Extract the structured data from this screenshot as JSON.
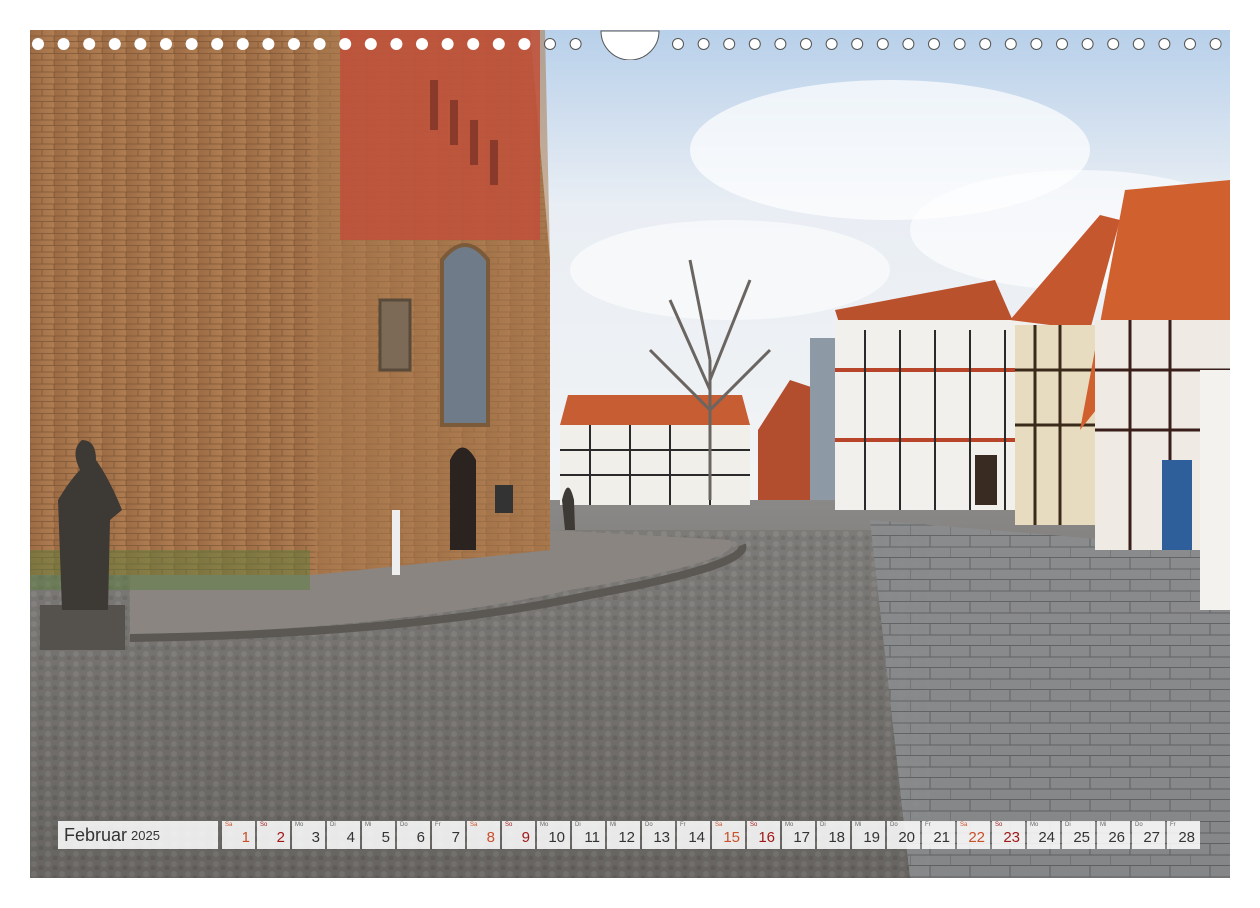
{
  "calendar": {
    "month": "Februar",
    "year": "2025",
    "days": [
      {
        "wd": "Sa",
        "d": "1",
        "t": "sat"
      },
      {
        "wd": "So",
        "d": "2",
        "t": "sun"
      },
      {
        "wd": "Mo",
        "d": "3",
        "t": ""
      },
      {
        "wd": "Di",
        "d": "4",
        "t": ""
      },
      {
        "wd": "Mi",
        "d": "5",
        "t": ""
      },
      {
        "wd": "Do",
        "d": "6",
        "t": ""
      },
      {
        "wd": "Fr",
        "d": "7",
        "t": ""
      },
      {
        "wd": "Sa",
        "d": "8",
        "t": "sat"
      },
      {
        "wd": "So",
        "d": "9",
        "t": "sun"
      },
      {
        "wd": "Mo",
        "d": "10",
        "t": ""
      },
      {
        "wd": "Di",
        "d": "11",
        "t": ""
      },
      {
        "wd": "Mi",
        "d": "12",
        "t": ""
      },
      {
        "wd": "Do",
        "d": "13",
        "t": ""
      },
      {
        "wd": "Fr",
        "d": "14",
        "t": ""
      },
      {
        "wd": "Sa",
        "d": "15",
        "t": "sat"
      },
      {
        "wd": "So",
        "d": "16",
        "t": "sun"
      },
      {
        "wd": "Mo",
        "d": "17",
        "t": ""
      },
      {
        "wd": "Di",
        "d": "18",
        "t": ""
      },
      {
        "wd": "Mi",
        "d": "19",
        "t": ""
      },
      {
        "wd": "Do",
        "d": "20",
        "t": ""
      },
      {
        "wd": "Fr",
        "d": "21",
        "t": ""
      },
      {
        "wd": "Sa",
        "d": "22",
        "t": "sat"
      },
      {
        "wd": "So",
        "d": "23",
        "t": "sun"
      },
      {
        "wd": "Mo",
        "d": "24",
        "t": ""
      },
      {
        "wd": "Di",
        "d": "25",
        "t": ""
      },
      {
        "wd": "Mi",
        "d": "26",
        "t": ""
      },
      {
        "wd": "Do",
        "d": "27",
        "t": ""
      },
      {
        "wd": "Fr",
        "d": "28",
        "t": ""
      }
    ]
  },
  "colors": {
    "sky": "#dfe9f4",
    "brick": "#a8764c",
    "roof": "#c9582e",
    "cobble": "#6f6e6c",
    "saturday": "#c8502a",
    "sunday": "#a01818"
  },
  "icons": {
    "binding": "calendar-ring-binding-icon",
    "hanger": "hanging-notch-icon"
  }
}
